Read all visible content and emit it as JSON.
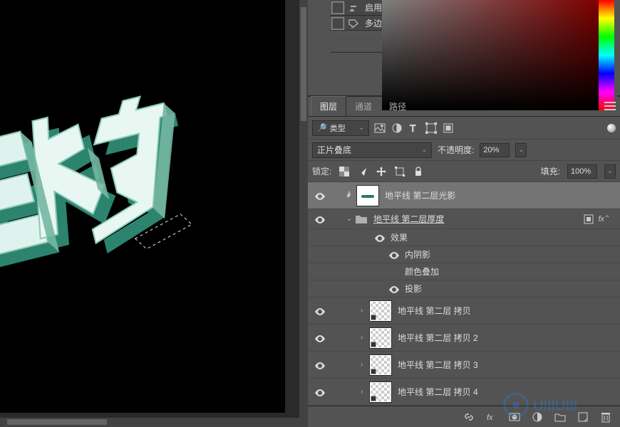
{
  "dropdown_section": {
    "item1": {
      "label": "启用画法效果"
    },
    "item2": {
      "label": "多边形套索"
    }
  },
  "tabs": {
    "layers": "图层",
    "channels": "通道",
    "paths": "路径"
  },
  "filter": {
    "kind_label": "类型"
  },
  "blend": {
    "mode": "正片叠底",
    "opacity_label": "不透明度:",
    "opacity_value": "20%"
  },
  "lock": {
    "label": "锁定:",
    "fill_label": "填充:",
    "fill_value": "100%"
  },
  "layers": {
    "l1": "地平线 第二层光影",
    "group1": "地平线  第二层厚度",
    "fx": "效果",
    "inner_shadow": "内阴影",
    "color_overlay": "颜色叠加",
    "drop_shadow": "投影",
    "copy1": "地平线 第二层  拷贝",
    "copy2": "地平线 第二层  拷贝 2",
    "copy3": "地平线 第二层  拷贝 3",
    "copy4": "地平线 第二层  拷贝 4",
    "fx_badge": "fx"
  },
  "icons": {
    "search": "🔍",
    "chev": "⌄"
  },
  "watermark": "UIIIUIII"
}
